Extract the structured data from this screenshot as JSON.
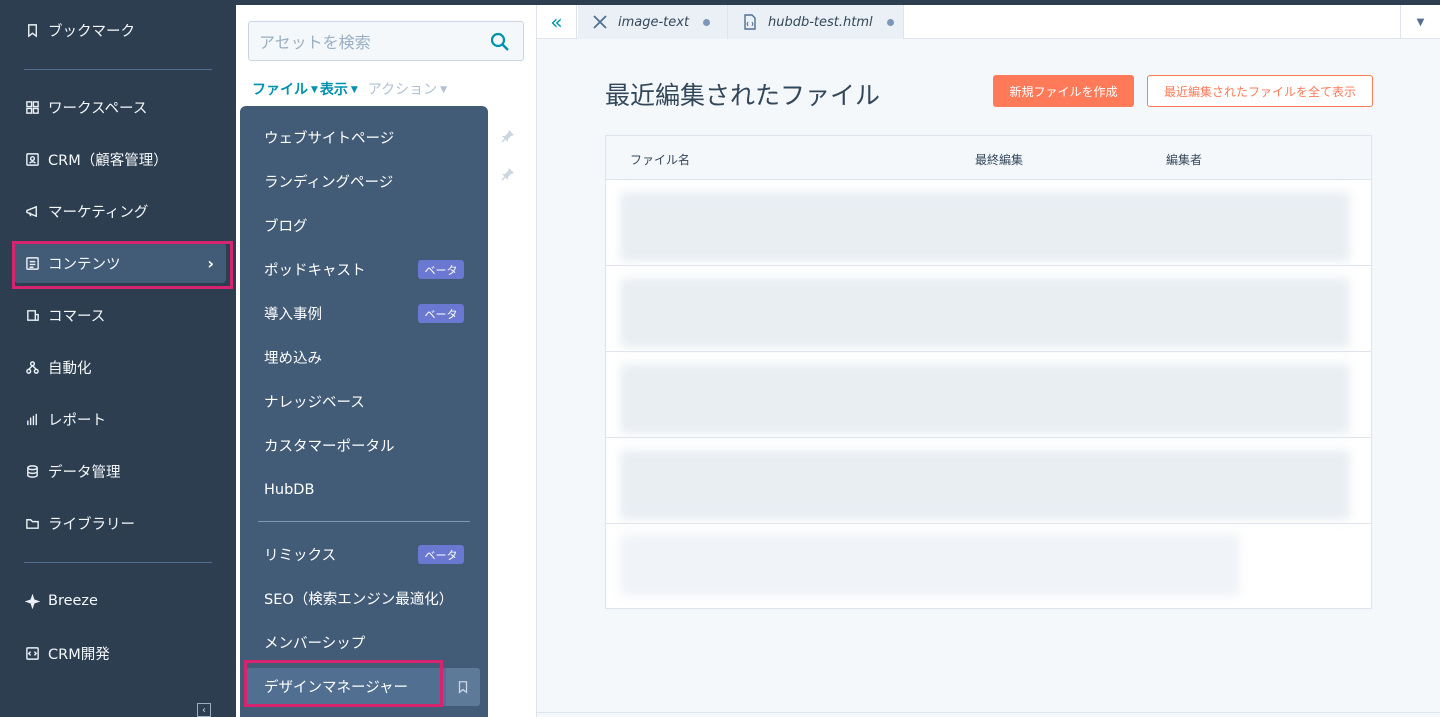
{
  "nav": {
    "items": [
      {
        "label": "ブックマーク",
        "icon": "bookmark-icon"
      },
      {
        "label": "ワークスペース",
        "icon": "grid-icon"
      },
      {
        "label": "CRM（顧客管理）",
        "icon": "contact-icon"
      },
      {
        "label": "マーケティング",
        "icon": "megaphone-icon"
      },
      {
        "label": "コンテンツ",
        "icon": "content-icon"
      },
      {
        "label": "コマース",
        "icon": "commerce-icon"
      },
      {
        "label": "自動化",
        "icon": "automation-icon"
      },
      {
        "label": "レポート",
        "icon": "reports-icon"
      },
      {
        "label": "データ管理",
        "icon": "database-icon"
      },
      {
        "label": "ライブラリー",
        "icon": "folder-icon"
      },
      {
        "label": "Breeze",
        "icon": "sparkle-icon"
      },
      {
        "label": "CRM開発",
        "icon": "code-icon"
      }
    ],
    "active_chevron": "›"
  },
  "filepanel": {
    "search_placeholder": "アセットを検索",
    "toolbar": {
      "file": "ファイル",
      "view": "表示",
      "action": "アクション"
    }
  },
  "dropdown": {
    "items": [
      {
        "label": "ウェブサイトページ"
      },
      {
        "label": "ランディングページ"
      },
      {
        "label": "ブログ"
      },
      {
        "label": "ポッドキャスト",
        "badge": "ベータ"
      },
      {
        "label": "導入事例",
        "badge": "ベータ"
      },
      {
        "label": "埋め込み"
      },
      {
        "label": "ナレッジベース"
      },
      {
        "label": "カスタマーポータル"
      },
      {
        "label": "HubDB"
      },
      {
        "label": "リミックス",
        "badge": "ベータ"
      },
      {
        "label": "SEO（検索エンジン最適化）"
      },
      {
        "label": "メンバーシップ"
      },
      {
        "label": "デザインマネージャー"
      }
    ]
  },
  "tabs": [
    {
      "label": "image-text",
      "icon": "tools-icon"
    },
    {
      "label": "hubdb-test.html",
      "icon": "file-code-icon"
    }
  ],
  "main": {
    "title": "最近編集されたファイル",
    "btn_new": "新規ファイルを作成",
    "btn_all": "最近編集されたファイルを全て表示",
    "columns": [
      "ファイル名",
      "最終編集",
      "編集者"
    ]
  },
  "colors": {
    "nav_bg": "#2d3e50",
    "dropdown_bg": "#425b76",
    "accent": "#ff7a59",
    "link": "#0091ae",
    "highlight": "#d6246e",
    "beta": "#6a78d1"
  }
}
